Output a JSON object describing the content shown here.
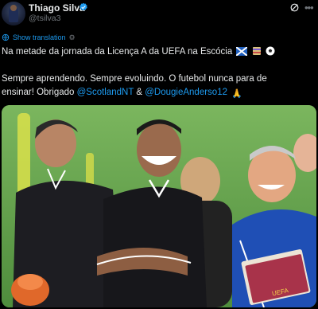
{
  "author": {
    "name": "Thiago Silva",
    "handle": "@tsilva3",
    "verified": true
  },
  "header": {
    "grok_icon": "grok-icon",
    "more_icon": "more-horizontal-icon"
  },
  "translation": {
    "label": "Show translation"
  },
  "post": {
    "line1": "Na metade da jornada da Licença A da UEFA na Escócia",
    "line2": "Sempre aprendendo. Sempre evoluindo. O futebol nunca para de",
    "line3_pre": "ensinar! Obrigado ",
    "mention1": "@ScotlandNT",
    "line3_mid": " & ",
    "mention2": "@DougieAnderso12",
    "emojis_line1": [
      "scotland-flag",
      "notebook",
      "soccer-ball"
    ],
    "emoji_line3": "folded-hands"
  },
  "colors": {
    "background": "#000000",
    "text": "#e7e9ea",
    "secondary": "#71767b",
    "accent": "#1d9bf0"
  },
  "media": {
    "type": "photo",
    "book_text": "UEFA"
  }
}
